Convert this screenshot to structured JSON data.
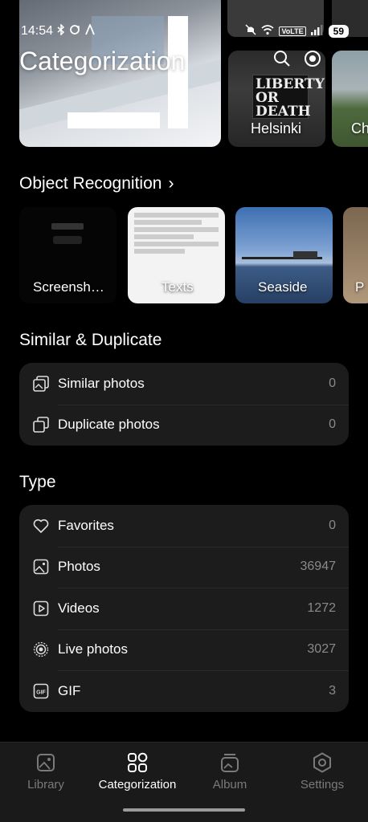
{
  "status_bar": {
    "time": "14:54",
    "volte": "VoLTE",
    "battery": "59"
  },
  "header": {
    "title": "Categorization"
  },
  "top_albums": [
    {
      "label": ""
    },
    {
      "label": "Helsinki",
      "sign_text": "LIBERTY\nOR\nDEATH"
    },
    {
      "label": "Ch"
    }
  ],
  "object_recognition": {
    "title": "Object Recognition",
    "chevron": "›",
    "items": [
      {
        "label": "Screensh…"
      },
      {
        "label": "Texts"
      },
      {
        "label": "Seaside"
      },
      {
        "label": "P"
      }
    ]
  },
  "similar_duplicate": {
    "title": "Similar & Duplicate",
    "rows": [
      {
        "label": "Similar photos",
        "count": "0",
        "icon": "similar-photos-icon"
      },
      {
        "label": "Duplicate photos",
        "count": "0",
        "icon": "duplicate-photos-icon"
      }
    ]
  },
  "type_section": {
    "title": "Type",
    "rows": [
      {
        "label": "Favorites",
        "count": "0",
        "icon": "heart-icon"
      },
      {
        "label": "Photos",
        "count": "36947",
        "icon": "photo-icon"
      },
      {
        "label": "Videos",
        "count": "1272",
        "icon": "video-icon"
      },
      {
        "label": "Live photos",
        "count": "3027",
        "icon": "live-photo-icon"
      },
      {
        "label": "GIF",
        "count": "3",
        "icon": "gif-icon"
      }
    ]
  },
  "bottom_nav": {
    "items": [
      {
        "label": "Library",
        "icon": "library-icon",
        "active": false
      },
      {
        "label": "Categorization",
        "icon": "categorization-icon",
        "active": true
      },
      {
        "label": "Album",
        "icon": "album-icon",
        "active": false
      },
      {
        "label": "Settings",
        "icon": "settings-icon",
        "active": false
      }
    ]
  },
  "colors": {
    "background": "#000000",
    "card": "#1c1c1c",
    "muted_text": "#8a8a8a",
    "nav_inactive": "#7a7a7a"
  }
}
